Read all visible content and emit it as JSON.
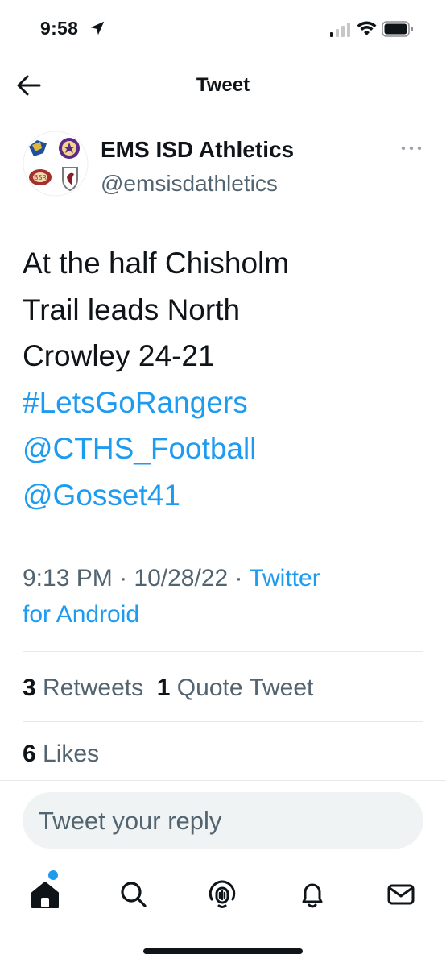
{
  "status_bar": {
    "time": "9:58"
  },
  "header": {
    "title": "Tweet"
  },
  "author": {
    "name": "EMS ISD Athletics",
    "handle": "@emsisdathletics"
  },
  "tweet": {
    "lines": [
      "At the half Chisholm",
      "Trail leads North",
      "Crowley 24-21"
    ],
    "hashtag": "#LetsGoRangers",
    "mentions": [
      "@CTHS_Football",
      "@Gosset41"
    ],
    "time": "9:13 PM",
    "separator": "·",
    "date": "10/28/22",
    "source_line1": "Twitter",
    "source_line2": "for Android"
  },
  "stats": {
    "retweets_count": "3",
    "retweets_label": "Retweets",
    "quotes_count": "1",
    "quotes_label": "Quote Tweet",
    "likes_count": "6",
    "likes_label": "Likes"
  },
  "reply": {
    "placeholder": "Tweet your reply"
  },
  "tabbar": {
    "items": [
      "home-icon",
      "search-icon",
      "spaces-icon",
      "notifications-icon",
      "messages-icon"
    ]
  },
  "colors": {
    "link": "#1d9bf0",
    "text": "#0f1419",
    "secondary": "#536471"
  }
}
